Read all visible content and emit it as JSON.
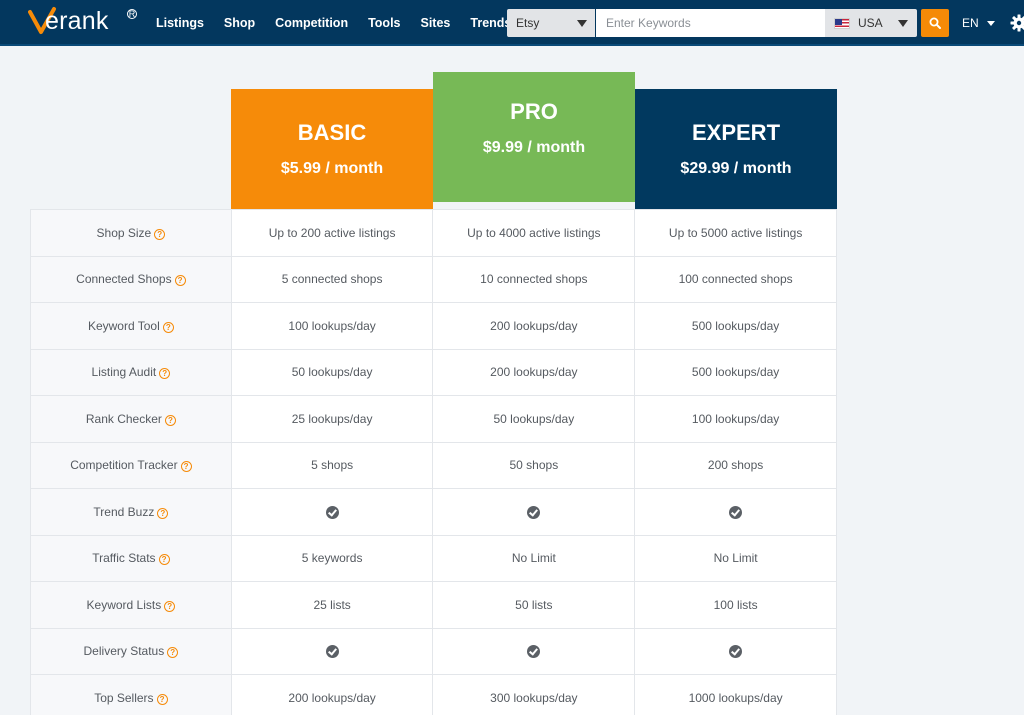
{
  "nav": {
    "brand": "erank",
    "links": [
      "Listings",
      "Shop",
      "Competition",
      "Tools",
      "Sites",
      "Trends"
    ],
    "platform": "Etsy",
    "search_placeholder": "Enter Keywords",
    "country": "USA",
    "language": "EN",
    "colors": {
      "bar": "#03375e",
      "accent": "#f58a07"
    }
  },
  "plans": [
    {
      "name": "BASIC",
      "price": "$5.99 / month",
      "color": "#f68b09"
    },
    {
      "name": "PRO",
      "price": "$9.99 / month",
      "color": "#77b956"
    },
    {
      "name": "EXPERT",
      "price": "$29.99 / month",
      "color": "#01395f"
    }
  ],
  "features": [
    {
      "name": "Shop Size",
      "basic": "Up to 200 active listings",
      "pro": "Up to 4000 active listings",
      "expert": "Up to 5000 active listings"
    },
    {
      "name": "Connected Shops",
      "basic": "5 connected shops",
      "pro": "10 connected shops",
      "expert": "100 connected shops"
    },
    {
      "name": "Keyword Tool",
      "basic": "100 lookups/day",
      "pro": "200 lookups/day",
      "expert": "500 lookups/day"
    },
    {
      "name": "Listing Audit",
      "basic": "50 lookups/day",
      "pro": "200 lookups/day",
      "expert": "500 lookups/day"
    },
    {
      "name": "Rank Checker",
      "basic": "25 lookups/day",
      "pro": "50 lookups/day",
      "expert": "100 lookups/day"
    },
    {
      "name": "Competition Tracker",
      "basic": "5 shops",
      "pro": "50 shops",
      "expert": "200 shops"
    },
    {
      "name": "Trend Buzz",
      "basic": "check-icon",
      "pro": "check-icon",
      "expert": "check-icon"
    },
    {
      "name": "Traffic Stats",
      "basic": "5 keywords",
      "pro": "No Limit",
      "expert": "No Limit"
    },
    {
      "name": "Keyword Lists",
      "basic": "25 lists",
      "pro": "50 lists",
      "expert": "100 lists"
    },
    {
      "name": "Delivery Status",
      "basic": "check-icon",
      "pro": "check-icon",
      "expert": "check-icon"
    },
    {
      "name": "Top Sellers",
      "basic": "200 lookups/day",
      "pro": "300 lookups/day",
      "expert": "1000 lookups/day"
    }
  ]
}
